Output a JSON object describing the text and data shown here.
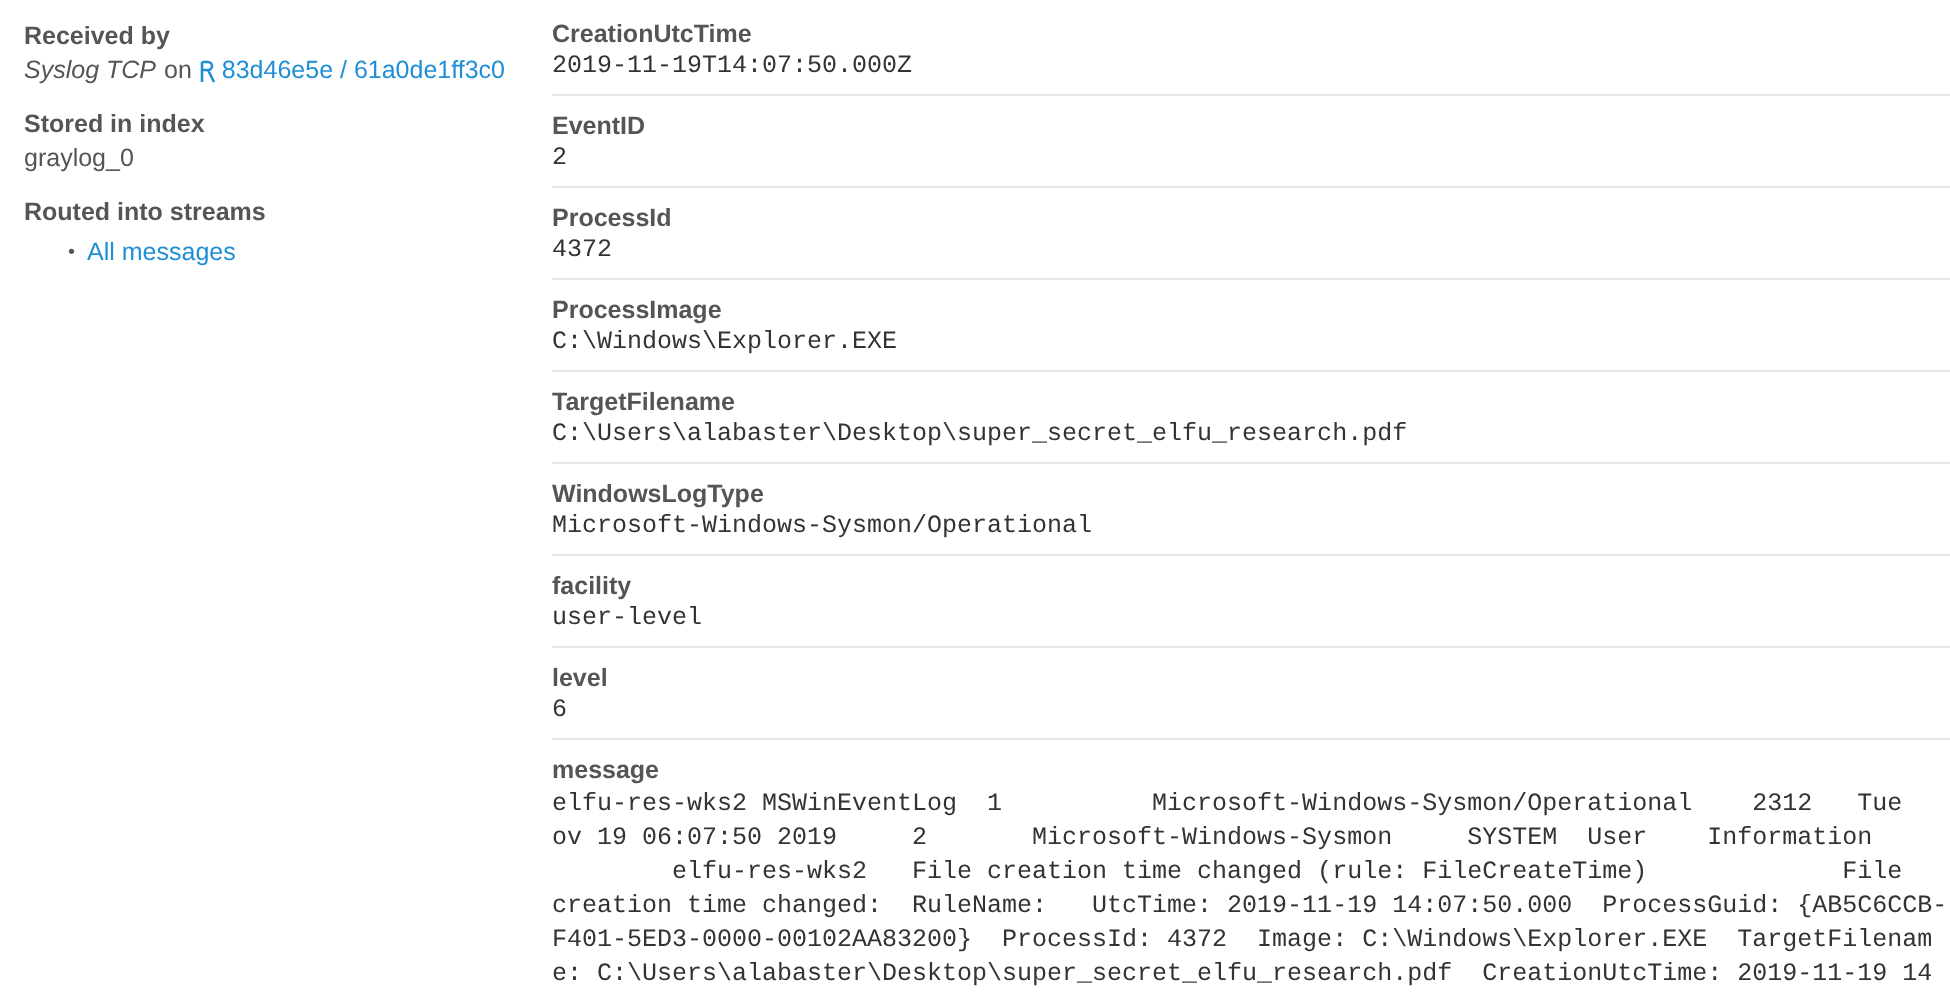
{
  "received_by": {
    "label": "Received by",
    "input": "Syslog TCP",
    "on": "on",
    "node_link": "83d46e5e / 61a0de1ff3c0"
  },
  "stored_in_index": {
    "label": "Stored in index",
    "value": "graylog_0"
  },
  "routed_into_streams": {
    "label": "Routed into streams",
    "streams": [
      {
        "bullet": "•",
        "name": "All messages"
      }
    ]
  },
  "fields": [
    {
      "kind": "single",
      "name": "CreationUtcTime",
      "value": "2019-11-19T14:07:50.000Z"
    },
    {
      "kind": "single",
      "name": "EventID",
      "value": "2"
    },
    {
      "kind": "single",
      "name": "ProcessId",
      "value": "4372"
    },
    {
      "kind": "single",
      "name": "ProcessImage",
      "value": "C:\\Windows\\Explorer.EXE"
    },
    {
      "kind": "single",
      "name": "TargetFilename",
      "value": "C:\\Users\\alabaster\\Desktop\\super_secret_elfu_research.pdf"
    },
    {
      "kind": "single",
      "name": "WindowsLogType",
      "value": "Microsoft-Windows-Sysmon/Operational"
    },
    {
      "kind": "single",
      "name": "facility",
      "value": "user-level"
    },
    {
      "kind": "single",
      "name": "level",
      "value": "6"
    },
    {
      "kind": "multiline",
      "name": "message",
      "lines": [
        "elfu-res-wks2 MSWinEventLog  1          Microsoft-Windows-Sysmon/Operational    2312   Tue",
        "ov 19 06:07:50 2019     2       Microsoft-Windows-Sysmon     SYSTEM  User    Information",
        "        elfu-res-wks2   File creation time changed (rule: FileCreateTime)             File",
        "creation time changed:  RuleName:   UtcTime: 2019-11-19 14:07:50.000  ProcessGuid: {AB5C6CCB-",
        "F401-5ED3-0000-00102AA83200}  ProcessId: 4372  Image: C:\\Windows\\Explorer.EXE  TargetFilenam",
        "e: C:\\Users\\alabaster\\Desktop\\super_secret_elfu_research.pdf  CreationUtcTime: 2019-11-19 14"
      ]
    }
  ]
}
